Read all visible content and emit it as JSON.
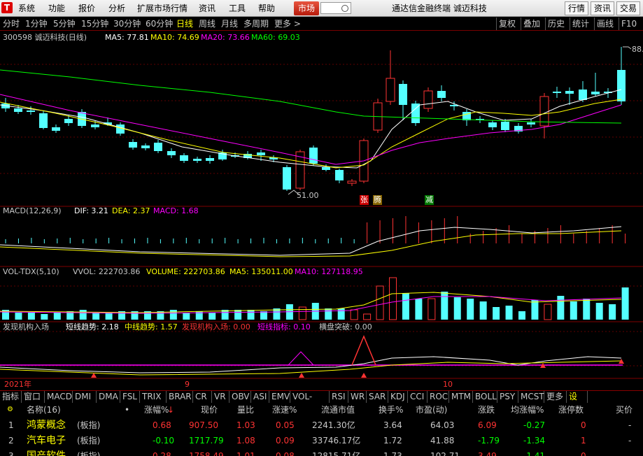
{
  "menubar": {
    "logo": "T",
    "items": [
      "系统",
      "功能",
      "报价",
      "分析",
      "扩展市场行情",
      "资讯",
      "工具",
      "帮助"
    ],
    "market": "市场",
    "title": "通达信金融终端  诚迈科技",
    "right_buttons": [
      "行情",
      "资讯",
      "交易"
    ]
  },
  "periodbar": {
    "periods": [
      "分时",
      "1分钟",
      "5分钟",
      "15分钟",
      "30分钟",
      "60分钟",
      "日线",
      "周线",
      "月线",
      "多周期",
      "更多 >"
    ],
    "active": "日线",
    "right_buttons": [
      "复权",
      "叠加",
      "历史",
      "统计",
      "画线",
      "F10"
    ]
  },
  "main_chart": {
    "header_code": "300598 诚迈科技(日线)",
    "ma5": "MA5: 77.81",
    "ma10": "MA10: 74.69",
    "ma20": "MA20: 73.66",
    "ma60": "MA60: 69.03",
    "high_label": "88.",
    "low_label": "51.00",
    "marker_zhang": "张",
    "marker_teng": "腾",
    "marker_jian": "减",
    "colors": {
      "ma5": "#ffffff",
      "ma10": "#ffff00",
      "ma20": "#ff00ff",
      "ma60": "#00ff00",
      "up": "#ff3333",
      "down": "#54ffff"
    }
  },
  "macd": {
    "name": "MACD(12,26,9)",
    "dif": "DIF: 3.21",
    "dea": "DEA: 2.37",
    "macd": "MACD: 1.68"
  },
  "vol": {
    "name": "VOL-TDX(5,10)",
    "vvol": "VVOL: 222703.86",
    "volume": "VOLUME: 222703.86",
    "ma5": "MA5: 135011.00",
    "ma10": "MA10: 127118.95"
  },
  "inst": {
    "name": "发现机构入场",
    "short_trend": "短线趋势: 2.18",
    "mid_trend": "中线趋势: 1.57",
    "enter": "发现机构入场: 0.00",
    "short_index": "短线指标: 0.10",
    "breakout": "横盘突破: 0.00"
  },
  "xaxis": {
    "year": "2021年",
    "m9": "9",
    "m10": "10"
  },
  "tabs": [
    "指标",
    "窗口",
    "MACD",
    "DMI",
    "DMA",
    "FSL",
    "TRIX",
    "BRAR",
    "CR",
    "VR",
    "OBV",
    "ASI",
    "EMV",
    "VOL-TDX",
    "RSI",
    "WR",
    "SAR",
    "KDJ",
    "CCI",
    "ROC",
    "MTM",
    "BOLL",
    "PSY",
    "MCST",
    "更多",
    "设置"
  ],
  "table": {
    "headers": {
      "name": "名称(16)",
      "dot": "•",
      "chg": "涨幅%",
      "price": "现价",
      "lb": "量比",
      "speed": "涨速%",
      "mv": "流通市值",
      "turn": "换手%",
      "pe": "市盈(动)",
      "zd": "涨跌",
      "avg": "均涨幅%",
      "zt": "涨停数",
      "buy": "买价"
    },
    "rows": [
      {
        "idx": "1",
        "name": "鸿蒙概念",
        "tag": "(板指)",
        "chg": "0.68",
        "price": "907.50",
        "lb": "1.03",
        "speed": "0.05",
        "mv": "2241.30亿",
        "turn": "3.64",
        "pe": "64.03",
        "zd": "6.09",
        "avg": "-0.27",
        "zt": "0",
        "buy": "-"
      },
      {
        "idx": "2",
        "name": "汽车电子",
        "tag": "(板指)",
        "chg": "-0.10",
        "price": "1717.79",
        "lb": "1.08",
        "speed": "0.09",
        "mv": "33746.17亿",
        "turn": "1.72",
        "pe": "41.88",
        "zd": "-1.79",
        "avg": "-1.34",
        "zt": "1",
        "buy": "-"
      },
      {
        "idx": "3",
        "name": "国产软件",
        "tag": "(板指)",
        "chg": "0.28",
        "price": "1758.49",
        "lb": "1.01",
        "speed": "0.08",
        "mv": "12815.71亿",
        "turn": "1.73",
        "pe": "102.71",
        "zd": "3.49",
        "avg": "-1.41",
        "zt": "0",
        "buy": "-"
      }
    ]
  }
}
